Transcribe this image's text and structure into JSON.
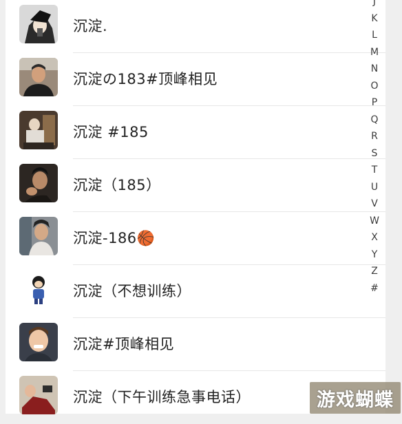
{
  "contacts": [
    {
      "name": "沉淀."
    },
    {
      "name": "沉淀の183#顶峰相见"
    },
    {
      "name": "沉淀 #185"
    },
    {
      "name": "沉淀（185）"
    },
    {
      "name": "沉淀-186🏀"
    },
    {
      "name": "沉淀（不想训练）"
    },
    {
      "name": "沉淀#顶峰相见"
    },
    {
      "name": "沉淀（下午训练急事电话）"
    }
  ],
  "index_bar": {
    "letters": [
      "J",
      "K",
      "L",
      "M",
      "N",
      "O",
      "P",
      "Q",
      "R",
      "S",
      "T",
      "U",
      "V",
      "W",
      "X",
      "Y",
      "Z",
      "#"
    ]
  },
  "watermark": {
    "text": "游戏蝴蝶"
  }
}
